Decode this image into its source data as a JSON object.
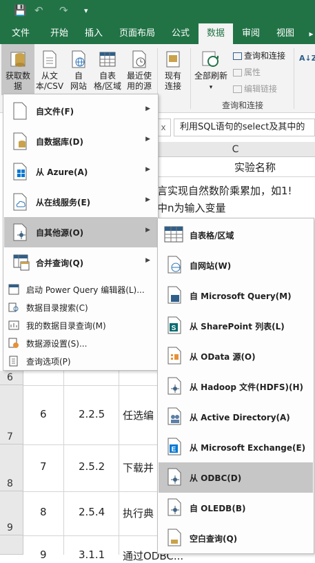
{
  "quick_access": {
    "save": "💾",
    "undo": "↶",
    "redo": "↷",
    "customize": "▾"
  },
  "tabs": [
    "文件",
    "开始",
    "插入",
    "页面布局",
    "公式",
    "数据",
    "审阅",
    "视图"
  ],
  "ribbon": {
    "get_data": "获取数\n据",
    "from_text_csv": "从文\n本/CSV",
    "from_web": "自\n网站",
    "from_table": "自表\n格/区域",
    "recent_sources": "最近使\n用的源",
    "existing_connections": "现有\n连接",
    "refresh_all": "全部刷新",
    "queries_connections": "查询和连接",
    "properties": "属性",
    "edit_links": "编辑链接",
    "group_label": "查询和连接",
    "sort_az": "A↓Z"
  },
  "formula_bar": {
    "text": "利用SQL语句的select及其中的",
    "x": "x"
  },
  "sheet": {
    "col_header": "C",
    "col_title": "实验名称",
    "line1": "言实现自然数阶乘累加，如1!",
    "line2": "中n为输入变量",
    "rows": [
      {
        "row": "6",
        "num": "",
        "ver": "",
        "text": ""
      },
      {
        "row": "7",
        "num": "6",
        "ver": "2.2.5",
        "text": "任选编"
      },
      {
        "row": "8",
        "num": "7",
        "ver": "2.5.2",
        "text": "下载并"
      },
      {
        "row": "9",
        "num": "8",
        "ver": "2.5.4",
        "text": "执行典"
      },
      {
        "row": "",
        "num": "9",
        "ver": "3.1.1",
        "text": "通过ODBC..."
      }
    ]
  },
  "menu": {
    "main_items": [
      {
        "label": "自文件(F)",
        "icon": "file-icon"
      },
      {
        "label": "自数据库(D)",
        "icon": "database-icon"
      },
      {
        "label": "从 Azure(A)",
        "icon": "azure-icon"
      },
      {
        "label": "从在线服务(E)",
        "icon": "cloud-icon"
      },
      {
        "label": "自其他源(O)",
        "icon": "other-sources-icon"
      },
      {
        "label": "合并查询(Q)",
        "icon": "combine-icon"
      }
    ],
    "small_items": [
      "启动 Power Query 编辑器(L)...",
      "数据目录搜索(C)",
      "我的数据目录查询(M)",
      "数据源设置(S)...",
      "查询选项(P)"
    ]
  },
  "submenu": {
    "items": [
      "自表格/区域",
      "自网站(W)",
      "自 Microsoft Query(M)",
      "从 SharePoint 列表(L)",
      "从 OData 源(O)",
      "从 Hadoop 文件(HDFS)(H)",
      "从 Active Directory(A)",
      "从 Microsoft Exchange(E)",
      "从 ODBC(D)",
      "自 OLEDB(B)",
      "空白查询(Q)"
    ]
  },
  "colors": {
    "excel_green": "#217346",
    "highlight": "#c6c6c6",
    "ribbon_bg": "#f3f3f3"
  }
}
